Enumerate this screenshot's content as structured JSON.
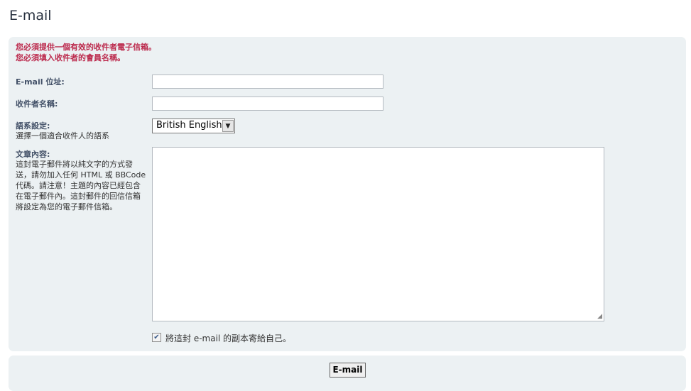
{
  "header": {
    "title": "E-mail"
  },
  "errors": [
    "您必須提供一個有效的收件者電子信箱。",
    "您必須填入收件者的會員名稱。"
  ],
  "form": {
    "email_label": "E-mail 位址:",
    "email_value": "",
    "name_label": "收件者名稱:",
    "name_value": "",
    "lang_label": "語系設定:",
    "lang_desc": "選擇一個適合收件人的語系",
    "lang_selected": "British English",
    "message_label": "文章內容:",
    "message_desc": "這封電子郵件將以純文字的方式發送，請勿加入任何 HTML 或 BBCode 代碼。請注意！主題的內容已經包含在電子郵件內。這封郵件的回信信箱將設定為您的電子郵件信箱。",
    "message_value": "",
    "cc_checked": true,
    "cc_label": "將這封 e-mail 的副本寄給自己。"
  },
  "actions": {
    "submit_label": "E-mail"
  },
  "icons": {
    "dropdown": "chevron-down-icon",
    "checkbox": "check-icon"
  },
  "colors": {
    "error": "#bc2a4d",
    "label": "#425067",
    "panel": "#ecf1f3"
  }
}
